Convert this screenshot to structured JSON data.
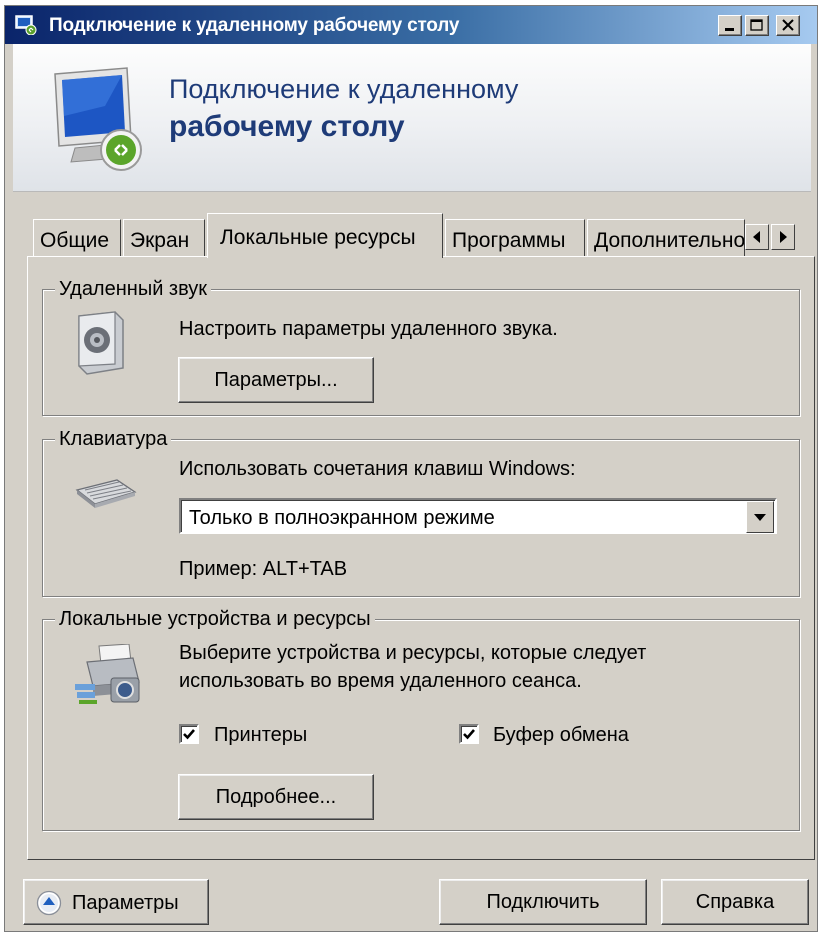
{
  "window": {
    "title": "Подключение к удаленному рабочему столу",
    "header_line1": "Подключение к удаленному",
    "header_line2": "рабочему столу"
  },
  "tabs": [
    {
      "label": "Общие"
    },
    {
      "label": "Экран"
    },
    {
      "label": "Локальные ресурсы",
      "active": true
    },
    {
      "label": "Программы"
    },
    {
      "label": "Дополнительно"
    }
  ],
  "audio": {
    "group_title": "Удаленный звук",
    "description": "Настроить параметры удаленного звука.",
    "button_label": "Параметры..."
  },
  "keyboard": {
    "group_title": "Клавиатура",
    "description": "Использовать сочетания клавиш Windows:",
    "selected_option": "Только в полноэкранном режиме",
    "example": "Пример: ALT+TAB"
  },
  "devices": {
    "group_title": "Локальные устройства и ресурсы",
    "description_line1": "Выберите устройства и ресурсы, которые следует",
    "description_line2": "использовать во время удаленного сеанса.",
    "printers_label": "Принтеры",
    "printers_checked": true,
    "clipboard_label": "Буфер обмена",
    "clipboard_checked": true,
    "more_button_label": "Подробнее..."
  },
  "footer": {
    "options_label": "Параметры",
    "connect_label": "Подключить",
    "help_label": "Справка"
  },
  "colors": {
    "title_gradient_start": "#0a246a",
    "title_gradient_end": "#a6caf0",
    "header_text": "#1e3b78",
    "face": "#d4d0c8"
  },
  "icons": [
    "rdp-app-icon",
    "minimize-icon",
    "maximize-icon",
    "close-icon",
    "remote-desktop-monitor-icon",
    "speaker-icon",
    "keyboard-icon",
    "devices-icon",
    "chevron-up-icon",
    "scroll-left-icon",
    "scroll-right-icon",
    "dropdown-arrow-icon",
    "checkmark-icon"
  ]
}
